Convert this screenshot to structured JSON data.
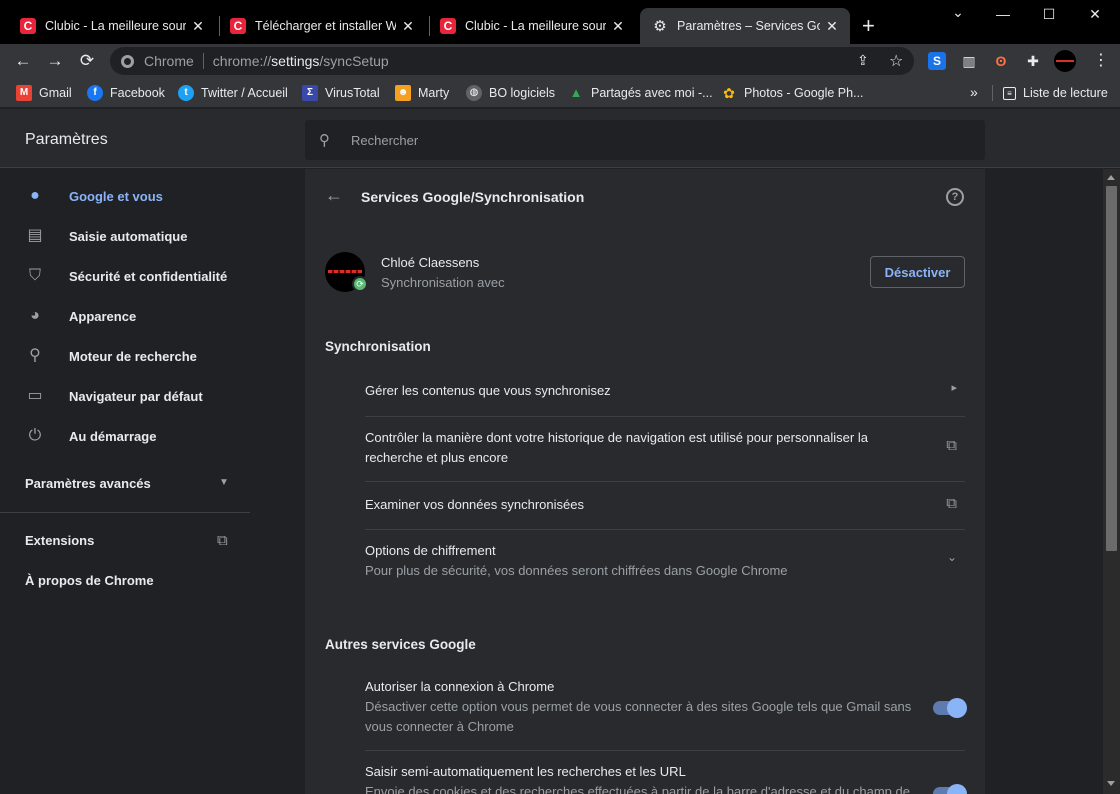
{
  "tabs": [
    {
      "title": "Clubic - La meilleure source d'information",
      "favicon": "clubic-icon",
      "active": false
    },
    {
      "title": "Télécharger et installer Windows",
      "favicon": "clubic-icon",
      "active": false
    },
    {
      "title": "Clubic - La meilleure source d'information",
      "favicon": "clubic-icon",
      "active": false
    },
    {
      "title": "Paramètres – Services Google",
      "favicon": "gear-icon",
      "active": true
    }
  ],
  "new_tab_label": "+",
  "window_controls": {
    "minimize": "—",
    "maximize": "☐",
    "close": "✕",
    "tabsearch": "⌄"
  },
  "toolbar": {
    "back": "←",
    "forward": "→",
    "reload": "⟳",
    "origin_label": "Chrome",
    "url_scheme": "chrome://",
    "url_host": "settings",
    "url_path": "/syncSetup",
    "share": "⇪",
    "star": "☆"
  },
  "extensions": [
    {
      "name": "s-extension-icon",
      "glyph": "S",
      "bg": "#1a73e8",
      "color": "#ffffff"
    },
    {
      "name": "trash-extension-icon",
      "glyph": "🗑",
      "bg": "transparent",
      "color": "#e8eaed"
    },
    {
      "name": "hub-extension-icon",
      "glyph": "ʘ",
      "bg": "transparent",
      "color": "#ff7043"
    },
    {
      "name": "puzzle-icon",
      "glyph": "✚",
      "bg": "transparent",
      "color": "#e8eaed"
    }
  ],
  "bookmarks": [
    {
      "label": "Gmail",
      "icon": "gmail-icon",
      "glyph": "M",
      "bg": "#ea4335"
    },
    {
      "label": "Facebook",
      "icon": "facebook-icon",
      "glyph": "f",
      "bg": "#1877f2"
    },
    {
      "label": "Twitter / Accueil",
      "icon": "twitter-icon",
      "glyph": "t",
      "bg": "#1da1f2"
    },
    {
      "label": "VirusTotal",
      "icon": "virustotal-icon",
      "glyph": "Σ",
      "bg": "#3949ab"
    },
    {
      "label": "Marty",
      "icon": "marty-icon",
      "glyph": "☻",
      "bg": "#f4a023"
    },
    {
      "label": "BO logiciels",
      "icon": "globe-icon",
      "glyph": "◍",
      "bg": "#5f6368"
    },
    {
      "label": "Partagés avec moi -...",
      "icon": "drive-icon",
      "glyph": "▲",
      "bg": "#34a853"
    },
    {
      "label": "Photos - Google Ph...",
      "icon": "photos-icon",
      "glyph": "✿",
      "bg": "#fbbc04"
    }
  ],
  "bookmarks_more": "»",
  "reading_list": "Liste de lecture",
  "settings": {
    "title": "Paramètres",
    "search_placeholder": "Rechercher"
  },
  "sidebar": {
    "items": [
      {
        "label": "Google et vous",
        "icon": "person-icon",
        "glyph": "👤",
        "selected": true
      },
      {
        "label": "Saisie automatique",
        "icon": "clipboard-icon",
        "glyph": "📋",
        "selected": false
      },
      {
        "label": "Sécurité et confidentialité",
        "icon": "shield-icon",
        "glyph": "⛉",
        "selected": false
      },
      {
        "label": "Apparence",
        "icon": "palette-icon",
        "glyph": "🎨",
        "selected": false
      },
      {
        "label": "Moteur de recherche",
        "icon": "search-icon",
        "glyph": "⚲",
        "selected": false
      },
      {
        "label": "Navigateur par défaut",
        "icon": "browser-icon",
        "glyph": "▭",
        "selected": false
      },
      {
        "label": "Au démarrage",
        "icon": "power-icon",
        "glyph": "⏻",
        "selected": false
      }
    ],
    "advanced": "Paramètres avancés",
    "extensions": "Extensions",
    "about": "À propos de Chrome"
  },
  "main": {
    "page_title": "Services Google/Synchronisation",
    "account": {
      "name": "Chloé Claessens",
      "status": "Synchronisation avec",
      "button": "Désactiver"
    },
    "sync_section": "Synchronisation",
    "sync_rows": [
      {
        "label": "Gérer les contenus que vous synchronisez",
        "sub": "",
        "icon": "chevron-right-icon"
      },
      {
        "label": "Contrôler la manière dont votre historique de navigation est utilisé pour personnaliser la",
        "label2": "recherche et plus encore",
        "icon": "external-link-icon"
      },
      {
        "label": "Examiner vos données synchronisées",
        "sub": "",
        "icon": "external-link-icon"
      },
      {
        "label": "Options de chiffrement",
        "sub": "Pour plus de sécurité, vos données seront chiffrées dans Google Chrome",
        "icon": "chevron-down-icon"
      }
    ],
    "other_section": "Autres services Google",
    "other_rows": [
      {
        "label": "Autoriser la connexion à Chrome",
        "sub": "Désactiver cette option vous permet de vous connecter à des sites Google tels que Gmail sans",
        "sub2": "vous connecter à Chrome",
        "on": true
      },
      {
        "label": "Saisir semi-automatiquement les recherches et les URL",
        "sub": "Envoie des cookies et des recherches effectuées à partir de la barre d'adresse et du champ de",
        "on": true
      }
    ]
  }
}
